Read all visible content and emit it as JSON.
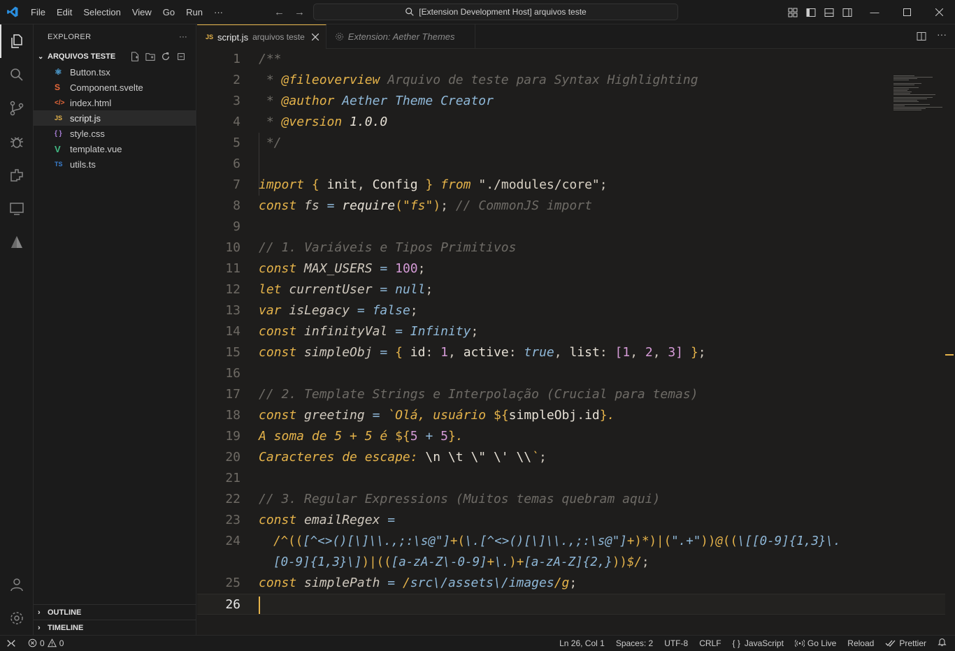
{
  "titlebar": {
    "menu": [
      "File",
      "Edit",
      "Selection",
      "View",
      "Go",
      "Run",
      "···"
    ],
    "command_center": "[Extension Development Host] arquivos teste"
  },
  "sidebar": {
    "title": "EXPLORER",
    "more": "···",
    "folder": "ARQUIVOS TESTE",
    "files": [
      {
        "name": "Button.tsx",
        "icon": "react-icon",
        "color": "#4fa3d9"
      },
      {
        "name": "Component.svelte",
        "icon": "svelte-icon",
        "color": "#e8683a"
      },
      {
        "name": "index.html",
        "icon": "html-icon",
        "color": "#e8683a"
      },
      {
        "name": "script.js",
        "icon": "js-icon",
        "color": "#e5b34a",
        "selected": true
      },
      {
        "name": "style.css",
        "icon": "css-icon",
        "color": "#a87ed6"
      },
      {
        "name": "template.vue",
        "icon": "vue-icon",
        "color": "#42b883"
      },
      {
        "name": "utils.ts",
        "icon": "ts-icon",
        "color": "#3a7fd0"
      }
    ],
    "outline": "OUTLINE",
    "timeline": "TIMELINE"
  },
  "tabs": {
    "active_label": "script.js",
    "active_desc": "arquivos teste",
    "active_icon": "JS",
    "inactive_label": "Extension: Aether Themes"
  },
  "code": {
    "line_numbers": [
      "1",
      "2",
      "3",
      "4",
      "5",
      "6",
      "7",
      "8",
      "9",
      "10",
      "11",
      "12",
      "13",
      "14",
      "15",
      "16",
      "17",
      "18",
      "19",
      "20",
      "21",
      "22",
      "23",
      "24",
      "",
      "25",
      "26"
    ],
    "current_line": "26"
  },
  "status": {
    "errors": "0",
    "warnings": "0",
    "position": "Ln 26, Col 1",
    "spaces": "Spaces: 2",
    "encoding": "UTF-8",
    "eol": "CRLF",
    "language": "JavaScript",
    "language_icon": "{ }",
    "golive": "Go Live",
    "reload": "Reload",
    "prettier": "Prettier"
  }
}
